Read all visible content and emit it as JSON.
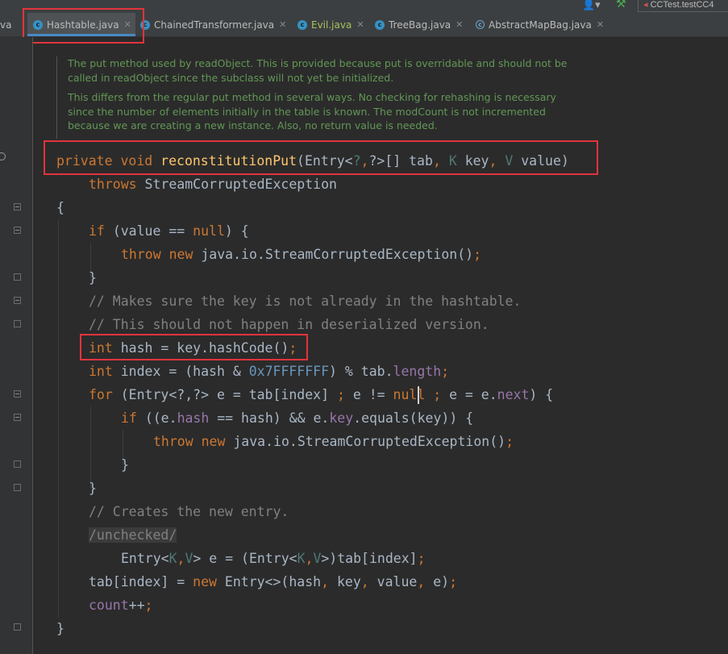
{
  "tabs": [
    {
      "label": "Hashtable.java",
      "icon": "class-icon",
      "active": true
    },
    {
      "label": "ChainedTransformer.java",
      "icon": "class-icon"
    },
    {
      "label": "Evil.java",
      "icon": "class-icon"
    },
    {
      "label": "TreeBag.java",
      "icon": "class-icon"
    },
    {
      "label": "AbstractMapBag.java",
      "icon": "abstract-class-icon"
    }
  ],
  "tab_fragment_left": "va",
  "run_config": "CCTest.testCC4",
  "doc_comment": {
    "para1": "The put method used by readObject. This is provided because put is overridable and should not be called in readObject since the subclass will not yet be initialized.",
    "para2": "This differs from the regular put method in several ways. No checking for rehashing is necessary since the number of elements initially in the table is known. The modCount is not incremented because we are creating a new instance. Also, no return value is needed."
  },
  "code": {
    "l1": {
      "a": "private void ",
      "b": "reconstitutionPut",
      "c": "(Entry<",
      "d": "?",
      "e": ",",
      "f": "?>[] tab",
      "g": ", ",
      "h": "K ",
      "i": "key",
      "j": ", ",
      "k": "V ",
      "l": "value)"
    },
    "l2": {
      "a": "throws ",
      "b": "StreamCorruptedException"
    },
    "l3": "{",
    "l4": {
      "a": "if ",
      "b": "(value == ",
      "c": "null",
      "d": ") {"
    },
    "l5": {
      "a": "throw new ",
      "b": "java.io.StreamCorruptedException()",
      "c": ";"
    },
    "l6": "}",
    "l7": "// Makes sure the key is not already in the hashtable.",
    "l8": "// This should not happen in deserialized version.",
    "l9": {
      "a": "int ",
      "b": "hash = key.hashCode()",
      "c": ";"
    },
    "l10": {
      "a": "int ",
      "b": "index = (hash & ",
      "c": "0x7FFFFFFF",
      "d": ") % tab.",
      "e": "length",
      "f": ";"
    },
    "l11": {
      "a": "for ",
      "b": "(Entry<?,?> e = tab[index] ",
      "c": "; ",
      "d": "e != ",
      "e": "null ",
      "f": "; ",
      "g": "e = e.",
      "h": "next",
      "i": ") {"
    },
    "l12": {
      "a": "if ",
      "b": "((e.",
      "c": "hash",
      "d": " == hash) && e.",
      "e": "key",
      "f": ".equals(key)) {"
    },
    "l13": {
      "a": "throw new ",
      "b": "java.io.StreamCorruptedException()",
      "c": ";"
    },
    "l14": "}",
    "l15": "}",
    "l16": "// Creates the new entry.",
    "l17": "/unchecked/",
    "l18": {
      "a": "Entry<",
      "b": "K",
      "c": ",",
      "d": "V",
      "e": "> e = (Entry<",
      "f": "K",
      "g": ",",
      "h": "V",
      "i": ">)tab[index]",
      "j": ";"
    },
    "l19": {
      "a": "tab[index] = ",
      "b": "new ",
      "c": "Entry<>(hash",
      "d": ", ",
      "e": "key",
      "f": ", ",
      "g": "value",
      "h": ", ",
      "i": "e)",
      "j": ";"
    },
    "l20": {
      "a": "count",
      "b": "++",
      "c": ";"
    },
    "l21": "}"
  },
  "colors": {
    "keyword": "#cc7832",
    "function": "#ffc66d",
    "comment": "#808080",
    "doc": "#629755",
    "number": "#6897bb",
    "field": "#9876aa",
    "highlight_box": "#e1343d"
  }
}
